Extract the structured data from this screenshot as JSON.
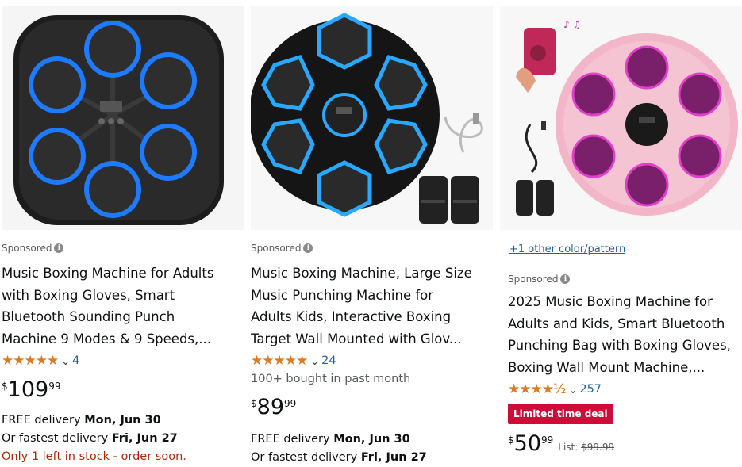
{
  "products": [
    {
      "sponsored_label": "Sponsored",
      "title_lines": [
        "Music Boxing Machine for Adults",
        "with Boxing Gloves, Smart",
        "Bluetooth Sounding Punch",
        "Machine 9 Modes & 9 Speeds,..."
      ],
      "stars": "★★★★★",
      "rating_value": 5,
      "review_count": "4",
      "price": {
        "currency": "$",
        "whole": "109",
        "fraction": "99"
      },
      "delivery": [
        {
          "prefix": "FREE delivery ",
          "date": "Mon, Jun 30"
        },
        {
          "prefix": "Or fastest delivery ",
          "date": "Fri, Jun 27"
        }
      ],
      "stock_note": "Only 1 left in stock - order soon."
    },
    {
      "sponsored_label": "Sponsored",
      "title_lines": [
        "Music Boxing Machine, Large Size",
        "Music Punching Machine for",
        "Adults Kids, Interactive Boxing",
        "Target Wall Mounted with Glov..."
      ],
      "stars": "★★★★★",
      "rating_value": 5,
      "review_count": "24",
      "bought": "100+ bought in past month",
      "price": {
        "currency": "$",
        "whole": "89",
        "fraction": "99"
      },
      "delivery": [
        {
          "prefix": "FREE delivery ",
          "date": "Mon, Jun 30"
        },
        {
          "prefix": "Or fastest delivery ",
          "date": "Fri, Jun 27"
        }
      ]
    },
    {
      "color_option": "+1 other color/pattern",
      "sponsored_label": "Sponsored",
      "title_lines": [
        "2025 Music Boxing Machine for",
        "Adults and Kids, Smart Bluetooth",
        "Punching Bag with Boxing Gloves,",
        "Boxing Wall Mount Machine,..."
      ],
      "stars": "★★★★½",
      "rating_value": 4.5,
      "review_count": "257",
      "deal_badge": "Limited time deal",
      "price": {
        "currency": "$",
        "whole": "50",
        "fraction": "99"
      },
      "list_label": "List: ",
      "list_price": "$99.99"
    }
  ],
  "colors": {
    "star": "#de7921",
    "link": "#2162a1",
    "deal": "#cc0c39",
    "stock": "#b12704",
    "pad_blue": "#1e7bff",
    "pad_pink": "#e040c8"
  },
  "icons": [
    "info-icon",
    "chevron-down-icon",
    "star-icon"
  ]
}
